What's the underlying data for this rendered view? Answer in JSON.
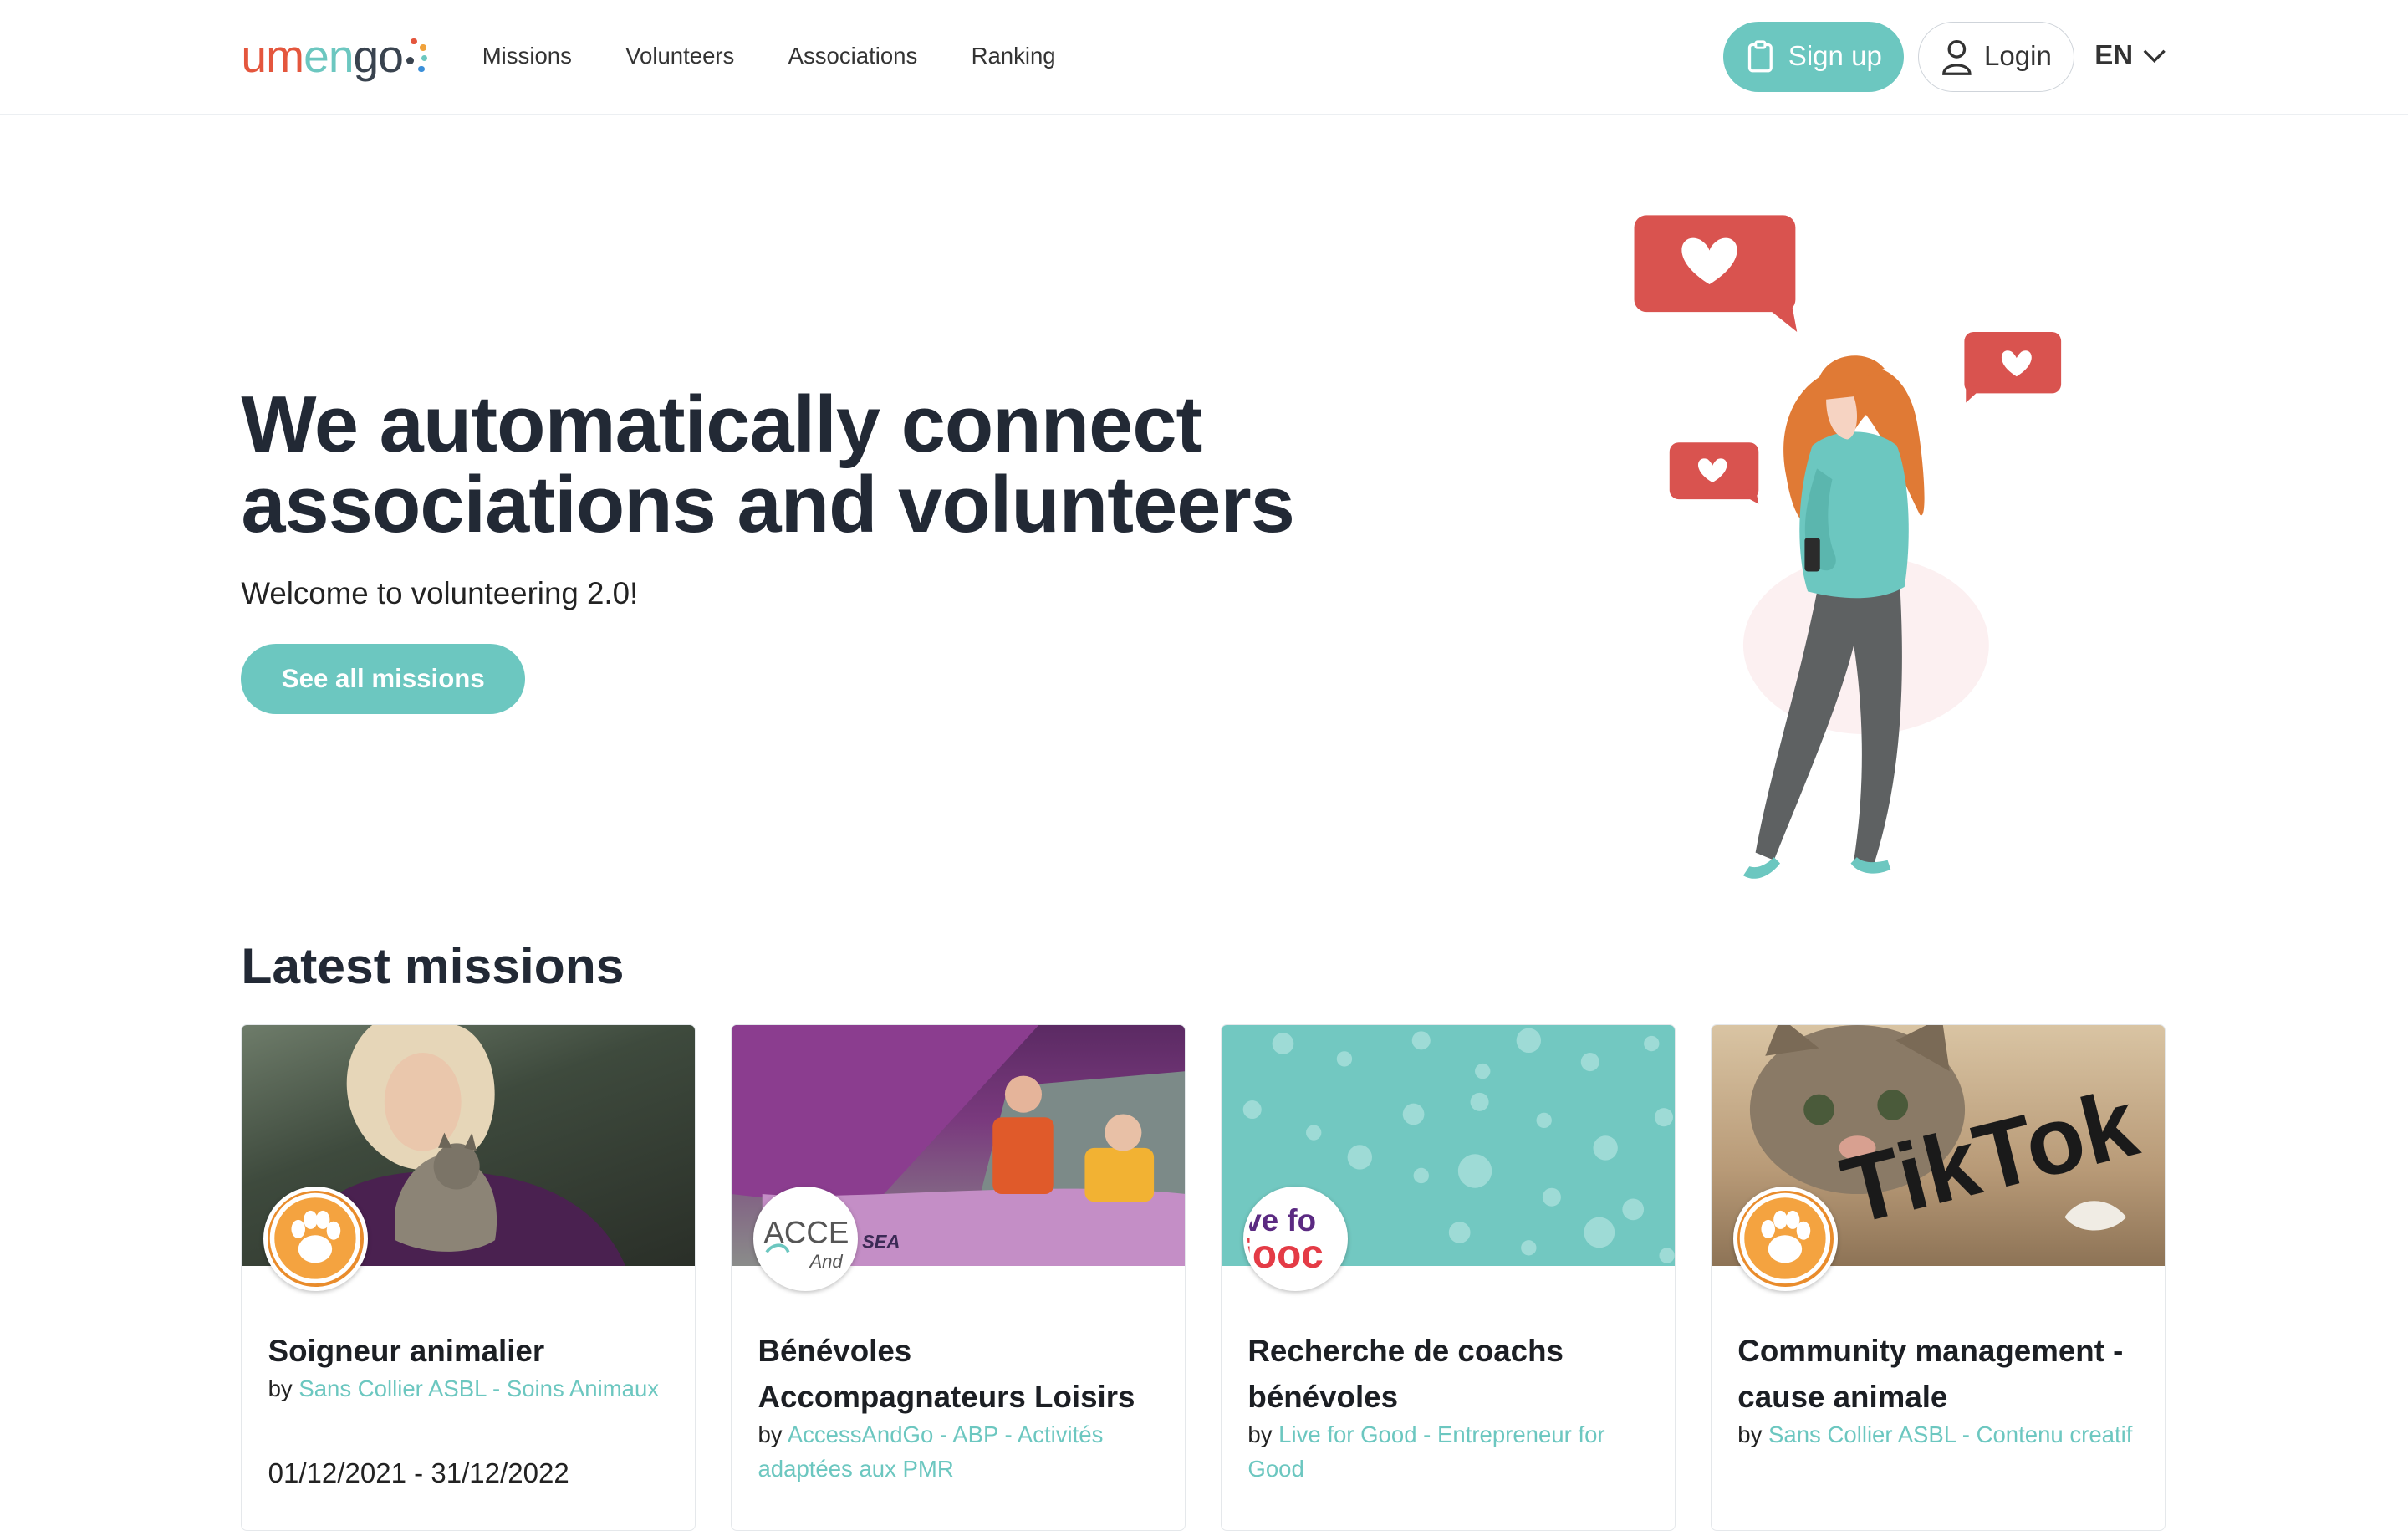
{
  "brand": {
    "logo_text": "umengo"
  },
  "nav": {
    "links": [
      "Missions",
      "Volunteers",
      "Associations",
      "Ranking"
    ],
    "signup_label": "Sign up",
    "login_label": "Login",
    "language": "EN"
  },
  "hero": {
    "title_line1": "We automatically connect",
    "title_line2": "associations and volunteers",
    "subtitle": "Welcome to volunteering 2.0!",
    "cta_label": "See all missions"
  },
  "missions": {
    "heading": "Latest missions",
    "by_label": "by",
    "cards": [
      {
        "title": "Soigneur animalier",
        "org": "Sans Collier ASBL - Soins Animaux",
        "dates": "01/12/2021 - 31/12/2022",
        "avatar": "paw-logo"
      },
      {
        "title": "Bénévoles Accompagnateurs Loisirs",
        "org": "AccessAndGo - ABP - Activités adaptées aux PMR",
        "avatar_text_top": "ACCE",
        "avatar_text_bottom": "And",
        "image_caption": "SEA"
      },
      {
        "title": "Recherche de coachs bénévoles",
        "org": "Live for Good - Entrepreneur for Good",
        "avatar_text_top": "ve fo",
        "avatar_text_bottom": "jooc"
      },
      {
        "title": "Community management - cause animale",
        "org": "Sans Collier ASBL - Contenu creatif",
        "image_text": "TikTok",
        "avatar": "paw-logo"
      }
    ]
  },
  "colors": {
    "accent": "#6cc7c0",
    "heart_bubble": "#d9534f",
    "hair": "#e07a35",
    "heading": "#222935"
  }
}
